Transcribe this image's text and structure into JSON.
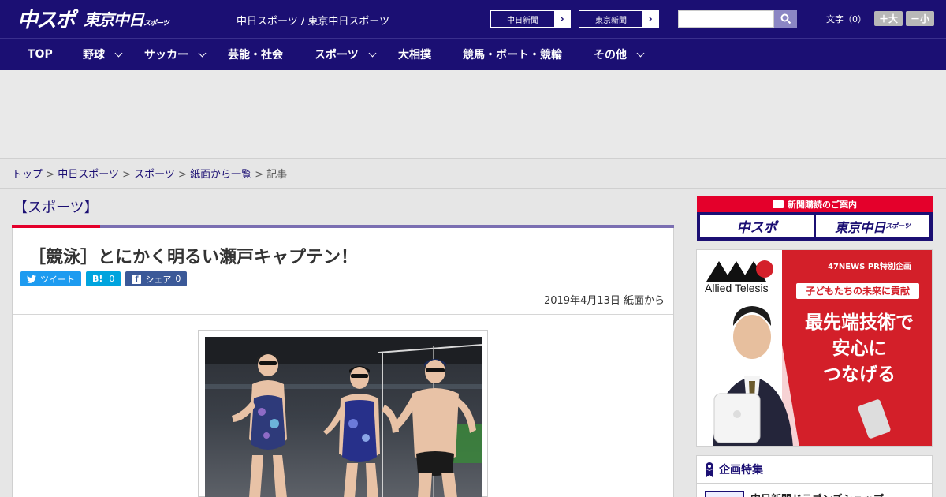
{
  "header": {
    "logo_chuspo": "中スポ",
    "logo_tokyo": "東京中日",
    "logo_tokyo_small": "スポーツ",
    "site_title": "中日スポーツ / 東京中日スポーツ",
    "paper_links": [
      {
        "label": "中日新聞",
        "arrow": "›"
      },
      {
        "label": "東京新聞",
        "arrow": "›"
      }
    ],
    "search": {
      "value": "",
      "placeholder": ""
    },
    "font_size": {
      "label": "文字（0）",
      "bigger": "＋大",
      "smaller": "－小"
    }
  },
  "nav": {
    "items": [
      {
        "label": "TOP",
        "has_dropdown": false
      },
      {
        "label": "野球",
        "has_dropdown": true
      },
      {
        "label": "サッカー",
        "has_dropdown": true
      },
      {
        "label": "芸能・社会",
        "has_dropdown": false
      },
      {
        "label": "スポーツ",
        "has_dropdown": true
      },
      {
        "label": "大相撲",
        "has_dropdown": false
      },
      {
        "label": "競馬・ボート・競輪",
        "has_dropdown": false
      },
      {
        "label": "その他",
        "has_dropdown": true
      }
    ]
  },
  "breadcrumb": {
    "items": [
      "トップ",
      "中日スポーツ",
      "スポーツ",
      "紙面から一覧"
    ],
    "separator": ">",
    "current": "記事"
  },
  "article": {
    "category": "【スポーツ】",
    "headline": "［競泳］とにかく明るい瀬戸キャプテン！",
    "share": {
      "tweet_label": "ツイート",
      "hatena_label": "B!",
      "hatena_count": "0",
      "fb_label": "シェア",
      "fb_count": "0"
    },
    "date": "2019年4月13日 紙面から"
  },
  "sidebar": {
    "subscription": {
      "title": "新聞購読のご案内",
      "btn_chuspo": "中スポ",
      "btn_tokyo": "東京中日",
      "btn_tokyo_small": "スポーツ"
    },
    "ad": {
      "brand": "Allied Telesis",
      "tag": "47NEWS PR特別企画",
      "sub": "子どもたちの未来に貢献",
      "lines": [
        "最先端技術で",
        "安心に",
        "つなげる"
      ]
    },
    "features": {
      "title": "企画特集",
      "first_item": "中日新聞ドラゴンズショップ"
    }
  },
  "colors": {
    "brand_navy": "#1b0f73",
    "accent_red": "#e4002b",
    "rule_purple": "#7b6fb2"
  }
}
